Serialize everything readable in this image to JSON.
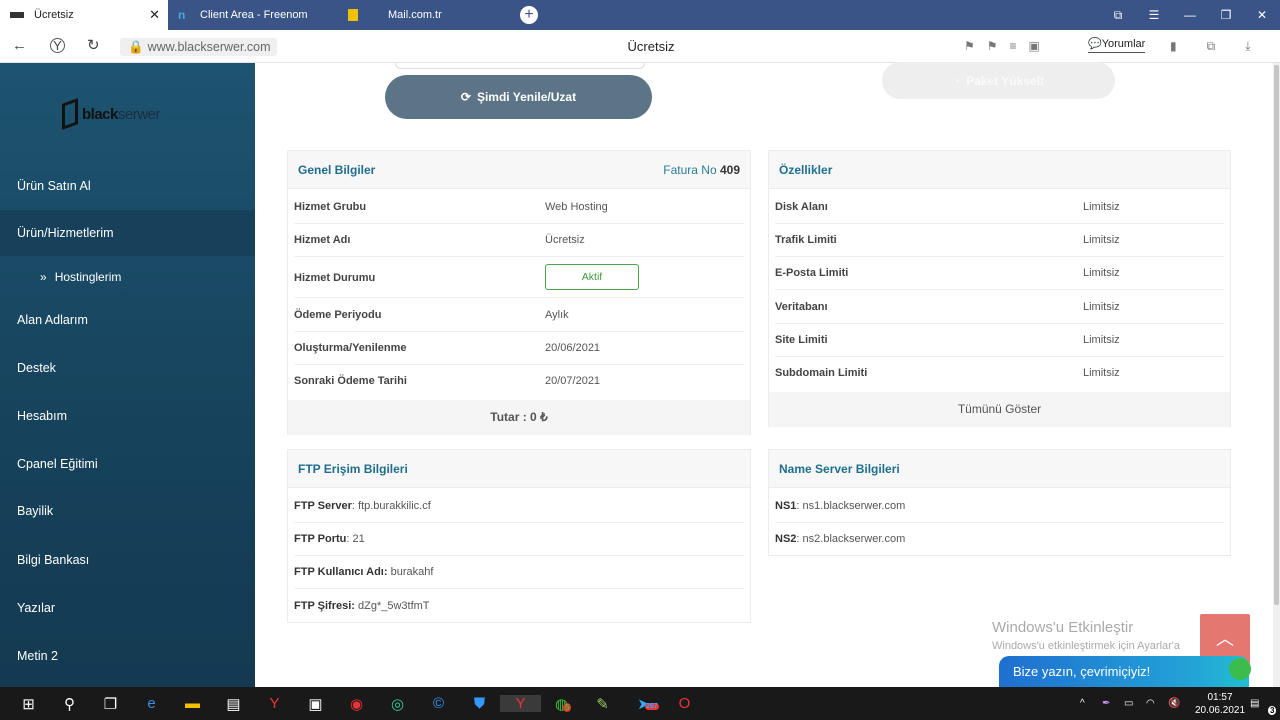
{
  "browser": {
    "tabs": [
      {
        "label": "Ücretsiz",
        "active": true
      },
      {
        "label": "Client Area - Freenom",
        "active": false
      },
      {
        "label": "Mail.com.tr",
        "active": false
      }
    ],
    "url": "www.blackserwer.com",
    "page_title": "Ücretsiz",
    "comments_label": "Yorumlar"
  },
  "sidebar": {
    "logo_text_a": "black",
    "logo_text_b": "serwer",
    "items": [
      {
        "label": "Ürün Satın Al"
      },
      {
        "label": "Ürün/Hizmetlerim",
        "active": true
      },
      {
        "label": "Alan Adlarım"
      },
      {
        "label": "Destek"
      },
      {
        "label": "Hesabım"
      },
      {
        "label": "Cpanel Eğitimi"
      },
      {
        "label": "Bayilik"
      },
      {
        "label": "Bilgi Bankası"
      },
      {
        "label": "Yazılar"
      },
      {
        "label": "Metin 2"
      }
    ],
    "sub_item": "Hostinglerim"
  },
  "actions": {
    "renew": "Şimdi Yenile/Uzat",
    "upgrade": "Paket Yükselt"
  },
  "general": {
    "title": "Genel Bilgiler",
    "invoice_label": "Fatura No",
    "invoice_no": "409",
    "rows": [
      {
        "key": "Hizmet Grubu",
        "value": "Web Hosting"
      },
      {
        "key": "Hizmet Adı",
        "value": "Ücretsiz"
      },
      {
        "key": "Hizmet Durumu",
        "value": "Aktif"
      },
      {
        "key": "Ödeme Periyodu",
        "value": "Aylık"
      },
      {
        "key": "Oluşturma/Yenilenme",
        "value": "20/06/2021"
      },
      {
        "key": "Sonraki Ödeme Tarihi",
        "value": "20/07/2021"
      }
    ],
    "total": "Tutar : 0 ₺"
  },
  "features": {
    "title": "Özellikler",
    "rows": [
      {
        "key": "Disk Alanı",
        "value": "Limitsiz"
      },
      {
        "key": "Trafik Limiti",
        "value": "Limitsiz"
      },
      {
        "key": "E-Posta Limiti",
        "value": "Limitsiz"
      },
      {
        "key": "Veritabanı",
        "value": "Limitsiz"
      },
      {
        "key": "Site Limiti",
        "value": "Limitsiz"
      },
      {
        "key": "Subdomain Limiti",
        "value": "Limitsiz"
      }
    ],
    "show_all": "Tümünü Göster"
  },
  "ftp": {
    "title": "FTP Erişim Bilgileri",
    "rows": [
      {
        "key": "FTP Server",
        "value": "ftp.burakkilic.cf"
      },
      {
        "key": "FTP Portu",
        "value": "21"
      },
      {
        "key": "FTP Kullanıcı Adı:",
        "value": "burakahf"
      },
      {
        "key": "FTP Şifresi:",
        "value": "dZg*_5w3tfmT"
      }
    ]
  },
  "nameserver": {
    "title": "Name Server Bilgileri",
    "rows": [
      {
        "key": "NS1",
        "value": "ns1.blackserwer.com"
      },
      {
        "key": "NS2",
        "value": "ns2.blackserwer.com"
      }
    ]
  },
  "watermark": {
    "title": "Windows'u Etkinleştir",
    "sub": "Windows'u etkinleştirmek için Ayarlar'a"
  },
  "chat_label": "Bize yazın, çevrimiçiyiz!",
  "taskbar": {
    "time": "01:57",
    "date": "20.06.2021",
    "notif_count": "3",
    "whatsapp_badge": "5",
    "telegram_badge": "267"
  },
  "colors": {
    "sidebar": "#1d5471",
    "accent": "#1f6e8e",
    "renew_button": "#5b7587",
    "status_green": "#3d9b3d"
  }
}
